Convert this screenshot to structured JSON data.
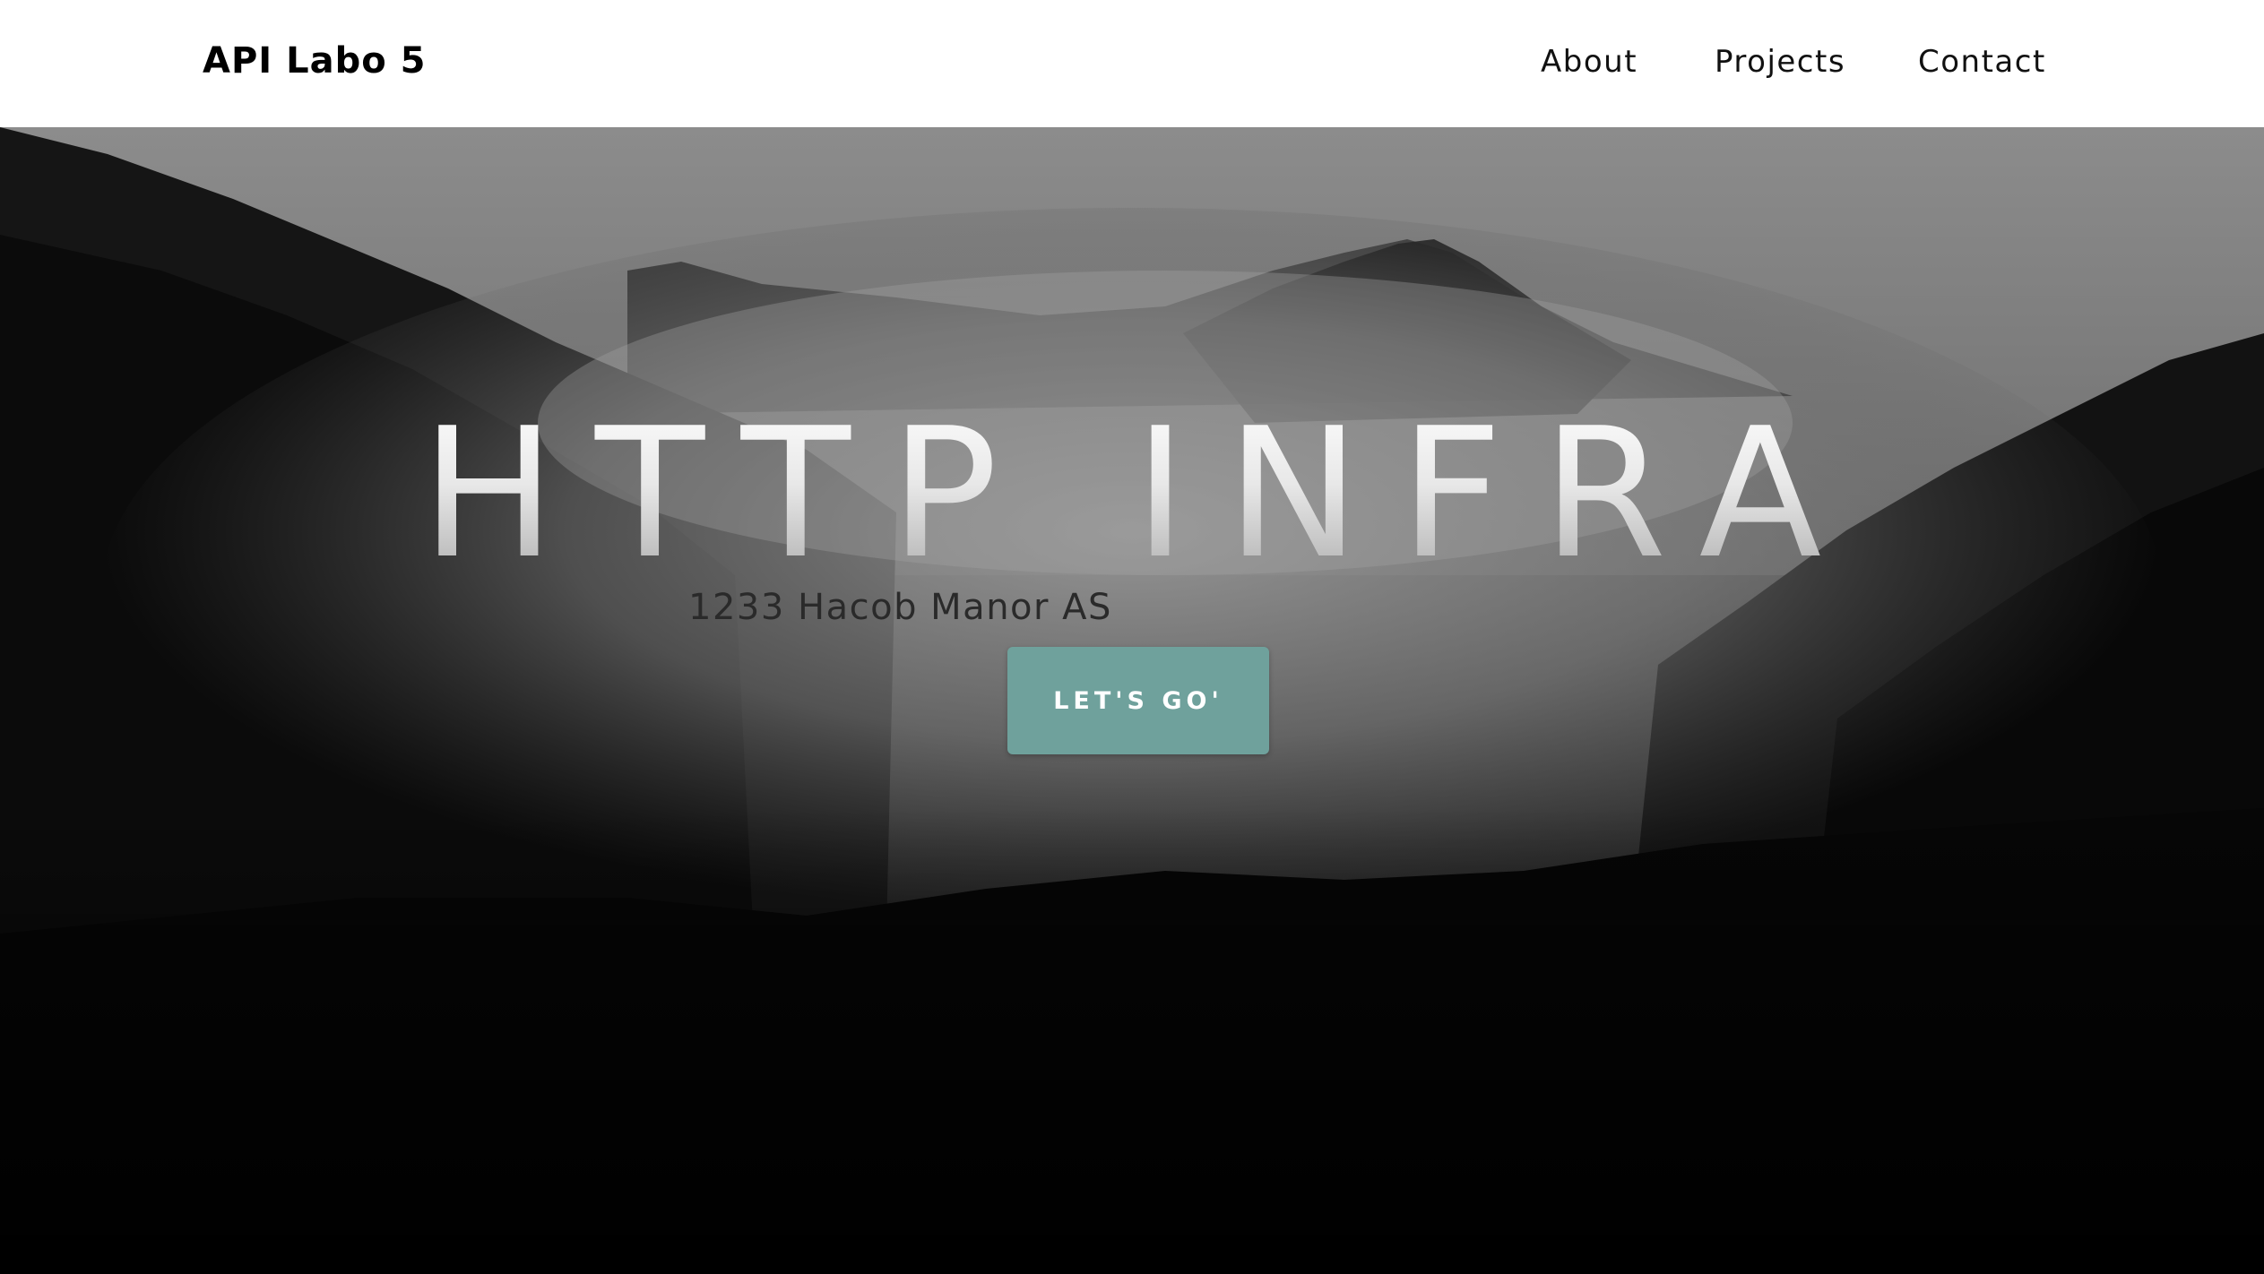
{
  "header": {
    "brand": "API Labo 5",
    "nav": {
      "about": "About",
      "projects": "Projects",
      "contact": "Contact"
    }
  },
  "hero": {
    "title": "HTTP INFRA",
    "subtitle": "1233 Hacob Manor AS",
    "button_label": "LET'S GO'",
    "button_color": "#6fa19c"
  }
}
